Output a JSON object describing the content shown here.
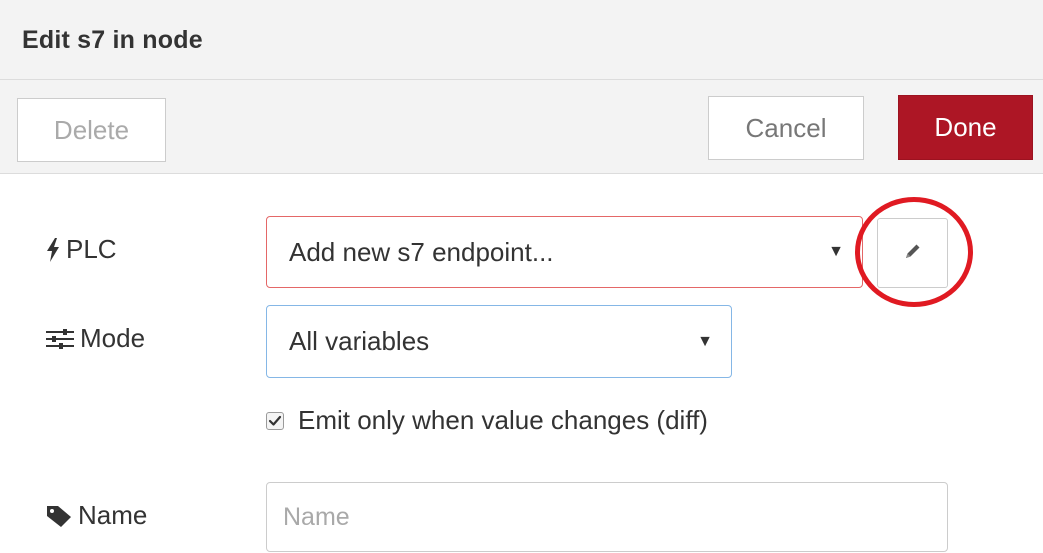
{
  "dialog": {
    "title": "Edit s7 in node"
  },
  "toolbar": {
    "delete_label": "Delete",
    "cancel_label": "Cancel",
    "done_label": "Done"
  },
  "form": {
    "plc": {
      "label": "PLC",
      "icon": "bolt-icon",
      "selected_value": "Add new s7 endpoint...",
      "edit_icon": "pencil-icon"
    },
    "mode": {
      "label": "Mode",
      "icon": "sliders-icon",
      "selected_value": "All variables"
    },
    "diff": {
      "label": "Emit only when value changes (diff)",
      "checked": true
    },
    "name": {
      "label": "Name",
      "icon": "tag-icon",
      "placeholder": "Name",
      "value": ""
    }
  },
  "colors": {
    "done_button": "#ad1625",
    "highlight_circle": "#e01a22",
    "plc_select_border": "#e46767",
    "mode_select_border": "#85b7e6"
  }
}
